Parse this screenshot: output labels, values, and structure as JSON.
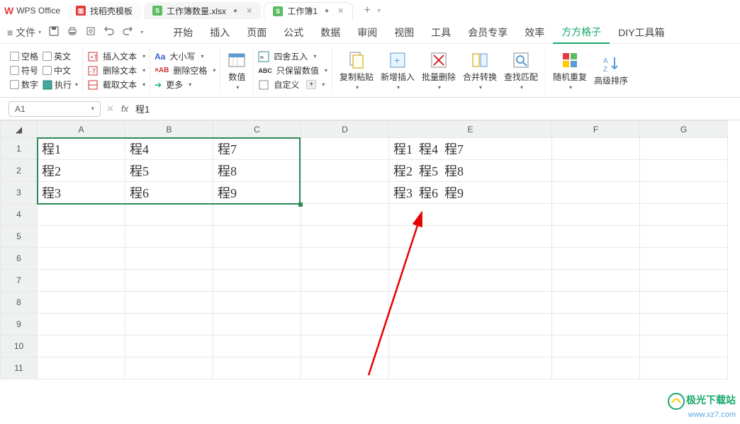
{
  "app": {
    "name": "WPS Office"
  },
  "tabs": [
    {
      "icon": "red",
      "iconLetter": "",
      "label": "找稻壳模板",
      "closable": false
    },
    {
      "icon": "grn",
      "iconLetter": "S",
      "label": "工作簿数量.xlsx",
      "closable": true,
      "dirty": true
    },
    {
      "icon": "grn",
      "iconLetter": "S",
      "label": "工作簿1",
      "closable": true,
      "dirty": true
    }
  ],
  "menu": {
    "file": "文件",
    "items": [
      "开始",
      "插入",
      "页面",
      "公式",
      "数据",
      "审阅",
      "视图",
      "工具",
      "会员专享",
      "效率",
      "方方格子",
      "DIY工具箱"
    ],
    "active": "方方格子"
  },
  "ribbon": {
    "checks": {
      "space": "空格",
      "eng": "英文",
      "sym": "符号",
      "cn": "中文",
      "num": "数字",
      "exec": "执行"
    },
    "g2": {
      "insertText": "插入文本",
      "deleteText": "删除文本",
      "extractText": "截取文本"
    },
    "g3": {
      "caseLabel": "大小写",
      "delSpace": "删除空格",
      "more": "更多"
    },
    "g4": {
      "numLabel": "数值",
      "round": "四舍五入",
      "keepNum": "只保留数值",
      "custom": "自定义"
    },
    "g5": {
      "copyPaste": "复制粘贴",
      "newInsert": "新增插入",
      "batchDel": "批量删除",
      "mergeConv": "合并转换",
      "findMatch": "查找匹配"
    },
    "g6": {
      "randRepeat": "随机重复",
      "advSort": "高级排序"
    }
  },
  "namebox": {
    "cell": "A1"
  },
  "formula": {
    "value": "程1"
  },
  "columns": [
    "A",
    "B",
    "C",
    "D",
    "E",
    "F",
    "G"
  ],
  "rows": [
    "1",
    "2",
    "3",
    "4",
    "5",
    "6",
    "7",
    "8",
    "9",
    "10",
    "11"
  ],
  "cells": {
    "A1": "程1",
    "B1": "程4",
    "C1": "程7",
    "A2": "程2",
    "B2": "程5",
    "C2": "程8",
    "A3": "程3",
    "B3": "程6",
    "C3": "程9",
    "E1": "程1  程4  程7",
    "E2": "程2  程5  程8",
    "E3": "程3  程6  程9"
  },
  "selection": {
    "col1": "A",
    "row1": 1,
    "col2": "C",
    "row2": 3
  },
  "watermark": {
    "line1": "极光下载站",
    "line2": "www.xz7.com"
  }
}
